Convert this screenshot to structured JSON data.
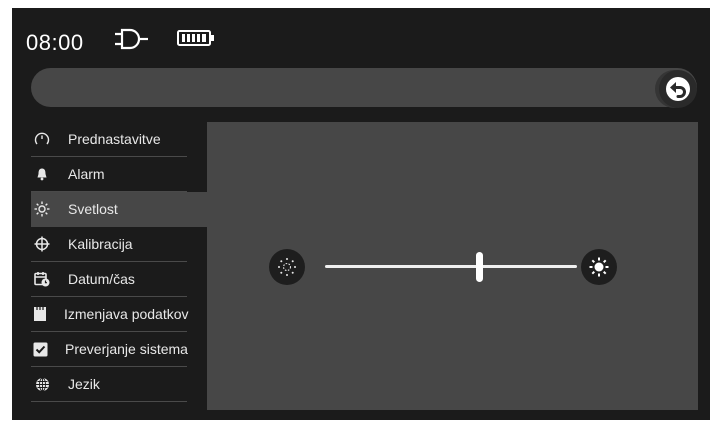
{
  "status": {
    "time": "08:00",
    "plug_icon": "power-plug-icon",
    "battery_icon": "battery-full-icon"
  },
  "titlebar": {
    "back_icon": "back-arrow-icon"
  },
  "menu": {
    "items": [
      {
        "label": "Prednastavitve",
        "icon": "gauge-icon",
        "selected": false
      },
      {
        "label": "Alarm",
        "icon": "bell-icon",
        "selected": false
      },
      {
        "label": "Svetlost",
        "icon": "brightness-icon",
        "selected": true
      },
      {
        "label": "Kalibracija",
        "icon": "crosshair-icon",
        "selected": false
      },
      {
        "label": "Datum/čas",
        "icon": "calendar-clock-icon",
        "selected": false
      },
      {
        "label": "Izmenjava podatkov",
        "icon": "sd-card-icon",
        "selected": false
      },
      {
        "label": "Preverjanje sistema",
        "icon": "checkbox-icon",
        "selected": false
      },
      {
        "label": "Jezik",
        "icon": "globe-icon",
        "selected": false
      }
    ]
  },
  "brightness": {
    "value": 0.61,
    "min_icon": "brightness-low-icon",
    "max_icon": "brightness-high-icon"
  },
  "colors": {
    "screen_bg": "#1b1b1b",
    "panel_bg": "#474747",
    "text": "#e8e8e8"
  }
}
